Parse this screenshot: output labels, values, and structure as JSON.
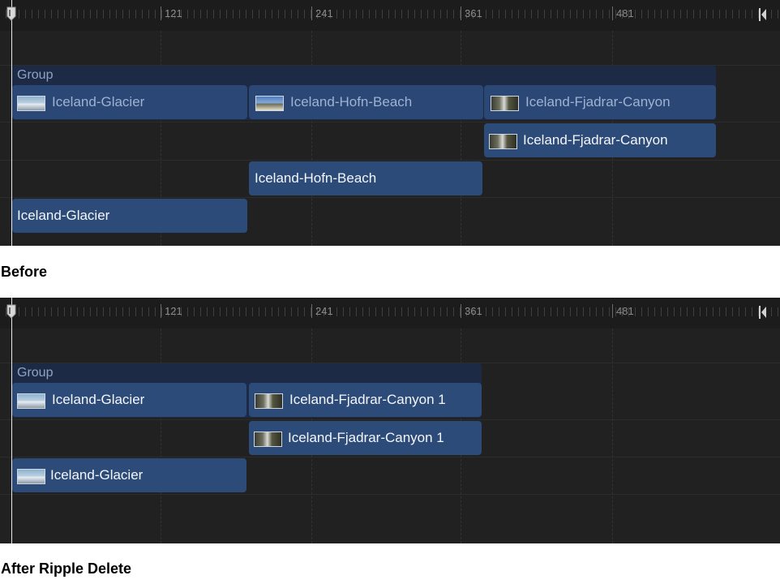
{
  "ruler": {
    "labels": [
      "121",
      "241",
      "361",
      "481"
    ]
  },
  "before": {
    "caption": "Before",
    "group_label": "Group",
    "group_clips": [
      "Iceland-Glacier",
      "Iceland-Hofn-Beach",
      "Iceland-Fjadrar-Canyon"
    ],
    "tracks": [
      "Iceland-Fjadrar-Canyon",
      "Iceland-Hofn-Beach",
      "Iceland-Glacier"
    ]
  },
  "after": {
    "caption": "After Ripple Delete",
    "group_label": "Group",
    "group_clips": [
      "Iceland-Glacier",
      "Iceland-Fjadrar-Canyon 1"
    ],
    "tracks": [
      "Iceland-Fjadrar-Canyon 1",
      "Iceland-Glacier"
    ]
  },
  "colors": {
    "panel": "#212121",
    "clip": "#2c4b78",
    "group": "#1c2a45",
    "playhead": "#e7e7e7"
  },
  "icons": {
    "playhead": "playhead-icon",
    "end_marker": "end-marker-icon",
    "clip_thumbnail": "thumbnail"
  }
}
